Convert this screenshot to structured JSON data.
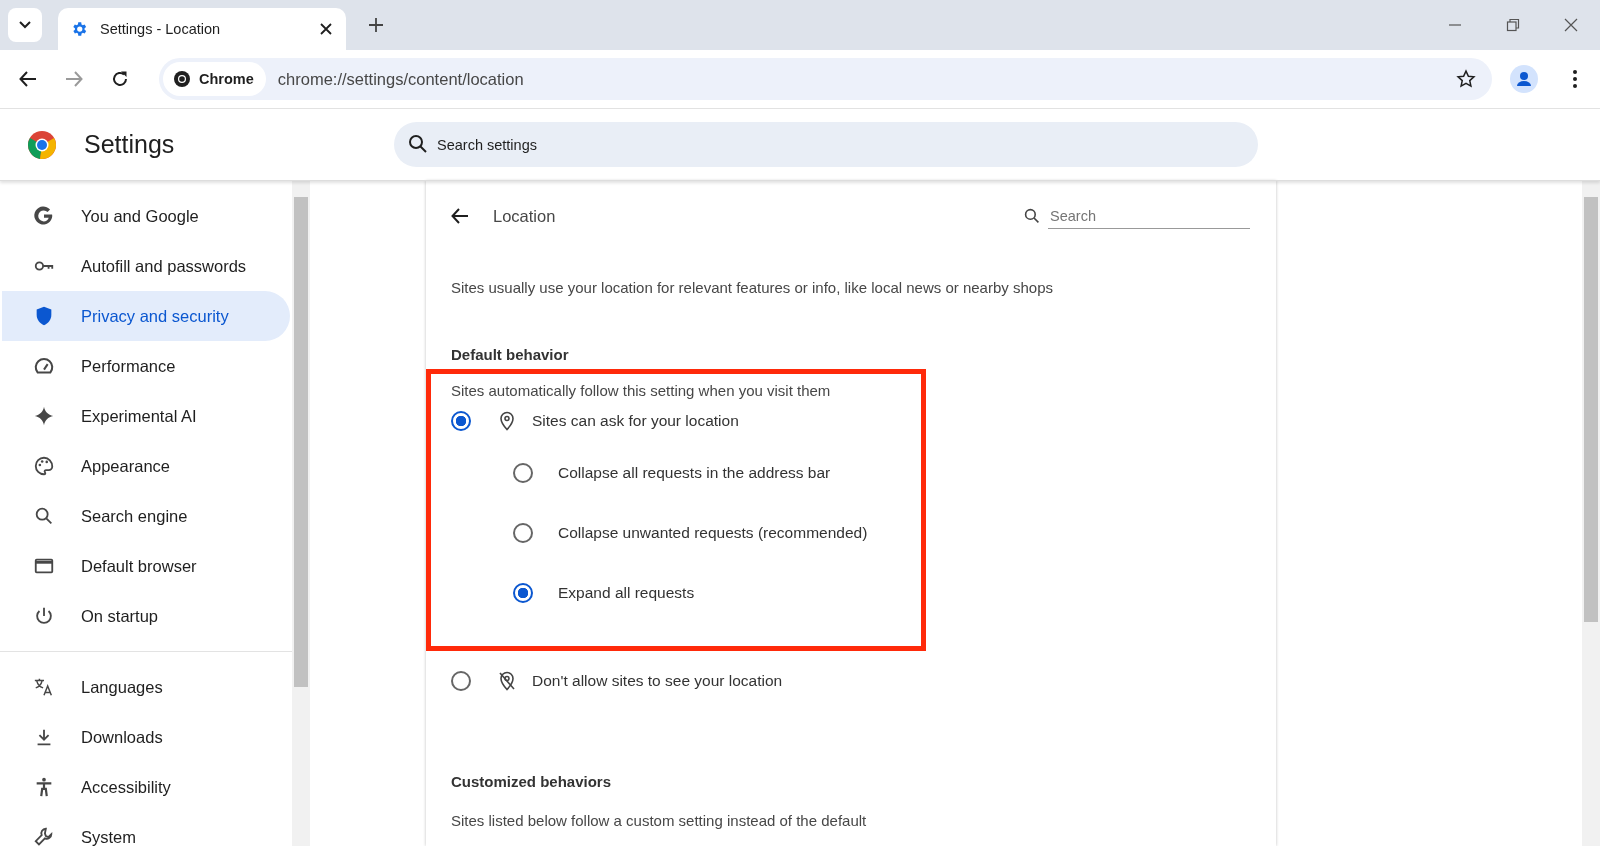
{
  "browser": {
    "tab": {
      "title": "Settings - Location"
    },
    "omnibox": {
      "chip": "Chrome",
      "url": "chrome://settings/content/location"
    }
  },
  "header": {
    "title": "Settings",
    "search": {
      "placeholder": "Search settings"
    }
  },
  "sidebar": {
    "sections": [
      [
        {
          "label": "You and Google",
          "kind": "google",
          "selected": false
        },
        {
          "label": "Autofill and passwords",
          "kind": "key",
          "selected": false
        },
        {
          "label": "Privacy and security",
          "kind": "shield",
          "selected": true
        },
        {
          "label": "Performance",
          "kind": "gauge",
          "selected": false
        },
        {
          "label": "Experimental AI",
          "kind": "spark",
          "selected": false
        },
        {
          "label": "Appearance",
          "kind": "palette",
          "selected": false
        },
        {
          "label": "Search engine",
          "kind": "search",
          "selected": false
        },
        {
          "label": "Default browser",
          "kind": "window",
          "selected": false
        },
        {
          "label": "On startup",
          "kind": "power",
          "selected": false
        }
      ],
      [
        {
          "label": "Languages",
          "kind": "translate",
          "selected": false
        },
        {
          "label": "Downloads",
          "kind": "download",
          "selected": false
        },
        {
          "label": "Accessibility",
          "kind": "person",
          "selected": false
        },
        {
          "label": "System",
          "kind": "wrench",
          "selected": false
        }
      ]
    ]
  },
  "page": {
    "title": "Location",
    "search": {
      "placeholder": "Search"
    },
    "description": "Sites usually use your location for relevant features or info, like local news or nearby shops",
    "default_behavior": {
      "heading": "Default behavior",
      "subtitle": "Sites automatically follow this setting when you visit them",
      "highlighted": true,
      "options": [
        {
          "label": "Sites can ask for your location",
          "kind": "pin",
          "selected": true,
          "children": [
            {
              "label": "Collapse all requests in the address bar",
              "selected": false
            },
            {
              "label": "Collapse unwanted requests (recommended)",
              "selected": false
            },
            {
              "label": "Expand all requests",
              "selected": true
            }
          ]
        },
        {
          "label": "Don't allow sites to see your location",
          "kind": "pin-off",
          "selected": false
        }
      ]
    },
    "customized": {
      "heading": "Customized behaviors",
      "subtitle": "Sites listed below follow a custom setting instead of the default"
    }
  }
}
